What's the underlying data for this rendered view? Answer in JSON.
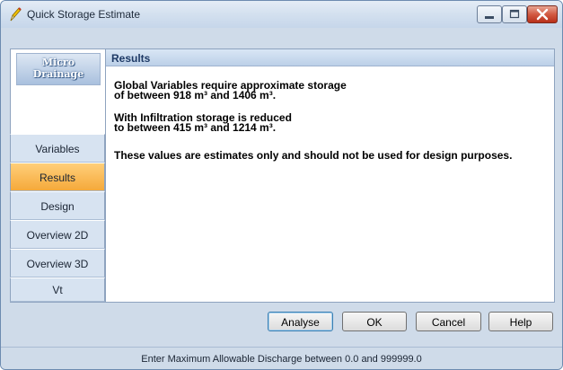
{
  "window": {
    "title": "Quick Storage Estimate"
  },
  "logo": {
    "line1": "Micro",
    "line2": "Drainage"
  },
  "nav": {
    "items": [
      {
        "label": "Variables",
        "active": false
      },
      {
        "label": "Results",
        "active": true
      },
      {
        "label": "Design",
        "active": false
      },
      {
        "label": "Overview 2D",
        "active": false
      },
      {
        "label": "Overview 3D",
        "active": false
      },
      {
        "label": "Vt",
        "active": false
      }
    ]
  },
  "results": {
    "header": "Results",
    "line1": "Global Variables require approximate storage",
    "line2": "of between 918 m³ and 1406 m³.",
    "line3": "With Infiltration storage is reduced",
    "line4": "to between 415 m³ and 1214 m³.",
    "line5": "These values are estimates only and should not be used for design purposes."
  },
  "buttons": {
    "analyse": "Analyse",
    "ok": "OK",
    "cancel": "Cancel",
    "help": "Help"
  },
  "status": {
    "text": "Enter Maximum Allowable Discharge between 0.0 and 999999.0"
  },
  "colors": {
    "active_nav": "#f5a93a",
    "close_button": "#d25a42",
    "panel_bg": "#cfdbe9"
  },
  "icons": {
    "title": "pencil-icon"
  }
}
